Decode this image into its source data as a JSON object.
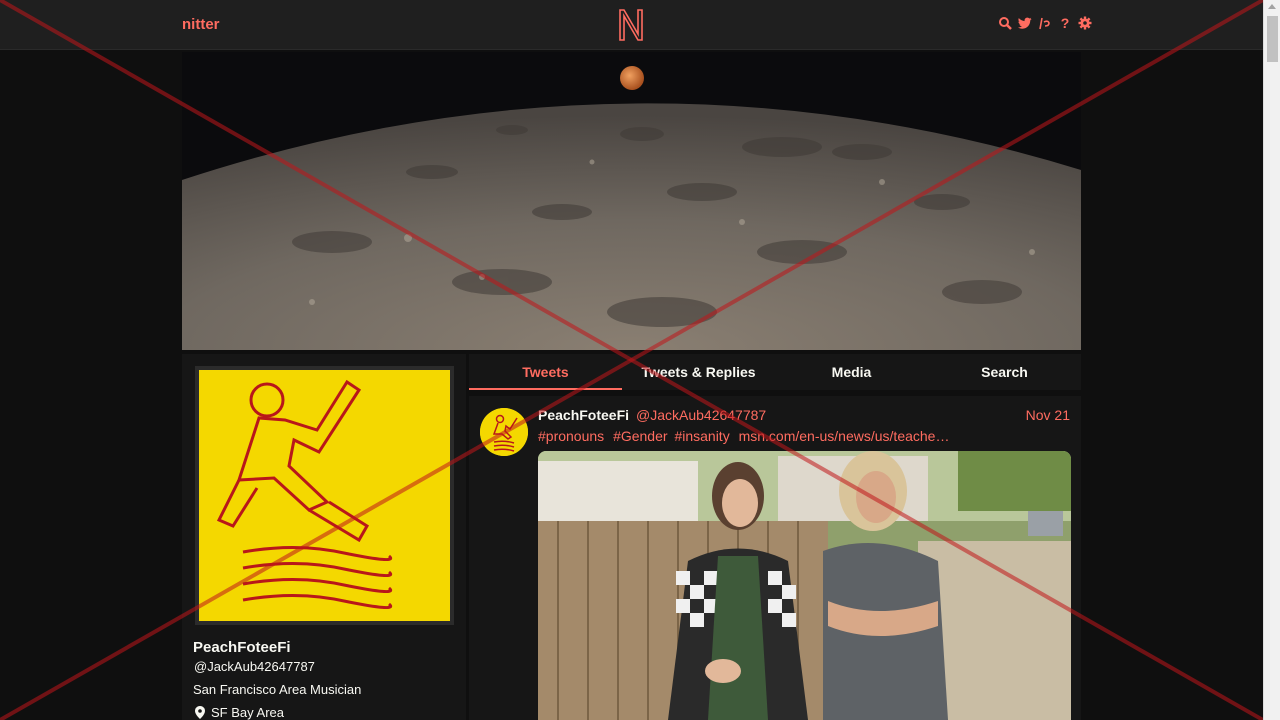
{
  "navbar": {
    "brand": "nitter",
    "logo_letter": "N",
    "icons": [
      "search-icon",
      "twitter-icon",
      "instance-icon",
      "help-icon",
      "gear-icon"
    ]
  },
  "profile": {
    "fullname": "PeachFoteeFi",
    "username": "@JackAub42647787",
    "bio": "San Francisco Area Musician",
    "location": "SF Bay Area"
  },
  "tabs": [
    {
      "label": "Tweets",
      "active": true
    },
    {
      "label": "Tweets & Replies",
      "active": false
    },
    {
      "label": "Media",
      "active": false
    },
    {
      "label": "Search",
      "active": false
    }
  ],
  "tweet": {
    "fullname": "PeachFoteeFi",
    "username": "@JackAub42647787",
    "date": "Nov 21",
    "content": {
      "hashtags": [
        "#pronouns",
        "#Gender",
        "#insanity"
      ],
      "link": "msn.com/en-us/news/us/teache…"
    }
  },
  "colors": {
    "accent": "#ff6c60",
    "background": "#0f0f0f",
    "panel": "#161616",
    "navbar": "#1f1f1f",
    "avatar_yellow": "#f4d800"
  }
}
